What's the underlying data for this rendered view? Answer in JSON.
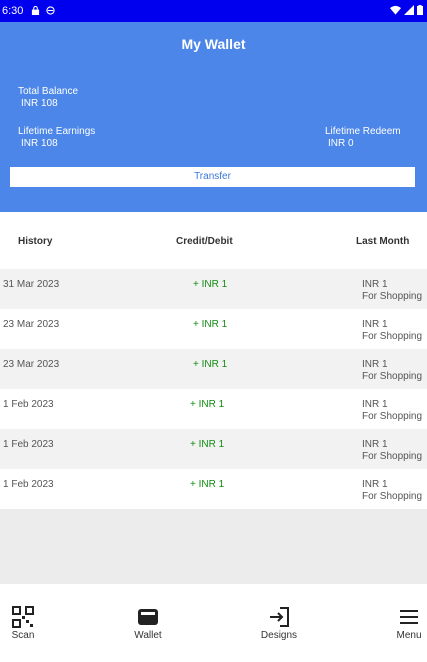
{
  "status_bar": {
    "time": "6:30",
    "icons": [
      "lock-icon",
      "circle-icon",
      "wifi-icon",
      "signal-icon",
      "battery-icon"
    ]
  },
  "header": {
    "title": "My Wallet",
    "total_balance_label": "Total Balance",
    "total_balance_value": "INR 108",
    "lifetime_earnings_label": "Lifetime Earnings",
    "lifetime_earnings_value": "INR 108",
    "lifetime_redeem_label": "Lifetime Redeem",
    "lifetime_redeem_value": "INR 0",
    "transfer_label": "Transfer",
    "bg_color": "#4c86e8"
  },
  "history": {
    "col_history": "History",
    "col_credit_debit": "Credit/Debit",
    "col_last_month": "Last Month",
    "rows": [
      {
        "date": "31 Mar 2023",
        "amount": "+ INR 1",
        "value": "INR 1",
        "desc": "For Shopping"
      },
      {
        "date": "23 Mar 2023",
        "amount": "+ INR 1",
        "value": "INR 1",
        "desc": "For Shopping"
      },
      {
        "date": "23 Mar 2023",
        "amount": "+ INR 1",
        "value": "INR 1",
        "desc": "For Shopping"
      },
      {
        "date": "1 Feb 2023",
        "amount": "+ INR 1",
        "value": "INR 1",
        "desc": "For Shopping"
      },
      {
        "date": "1 Feb 2023",
        "amount": "+ INR 1",
        "value": "INR 1",
        "desc": "For Shopping"
      },
      {
        "date": "1 Feb 2023",
        "amount": "+ INR 1",
        "value": "INR 1",
        "desc": "For Shopping"
      }
    ],
    "credit_color": "#128c12"
  },
  "bottom_nav": {
    "scan": "Scan",
    "wallet": "Wallet",
    "designs": "Designs",
    "menu": "Menu"
  }
}
